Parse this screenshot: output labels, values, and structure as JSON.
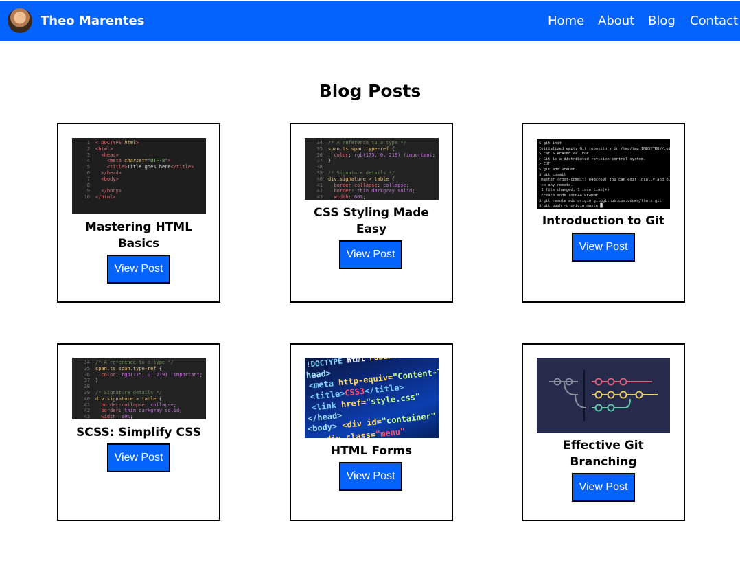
{
  "nav": {
    "brand": "Theo Marentes",
    "links": [
      "Home",
      "About",
      "Blog",
      "Contact"
    ]
  },
  "page": {
    "title": "Blog Posts"
  },
  "posts": [
    {
      "title_line1": "Mastering HTML",
      "title_line2": "Basics",
      "button": "View Post",
      "image": "html-code-screenshot"
    },
    {
      "title_line1": "CSS Styling Made",
      "title_line2": "Easy",
      "button": "View Post",
      "image": "css-code-screenshot"
    },
    {
      "title_line1": "Introduction to Git",
      "title_line2": "",
      "button": "View Post",
      "image": "git-terminal-screenshot"
    },
    {
      "title_line1": "SCSS: Simplify CSS",
      "title_line2": "",
      "button": "View Post",
      "image": "css-code-screenshot"
    },
    {
      "title_line1": "HTML Forms",
      "title_line2": "",
      "button": "View Post",
      "image": "html-source-closeup"
    },
    {
      "title_line1": "Effective Git",
      "title_line2": "Branching",
      "button": "View Post",
      "image": "git-branch-diagram"
    }
  ],
  "colors": {
    "primary": "#0563fd",
    "text": "#000000",
    "background": "#ffffff"
  }
}
